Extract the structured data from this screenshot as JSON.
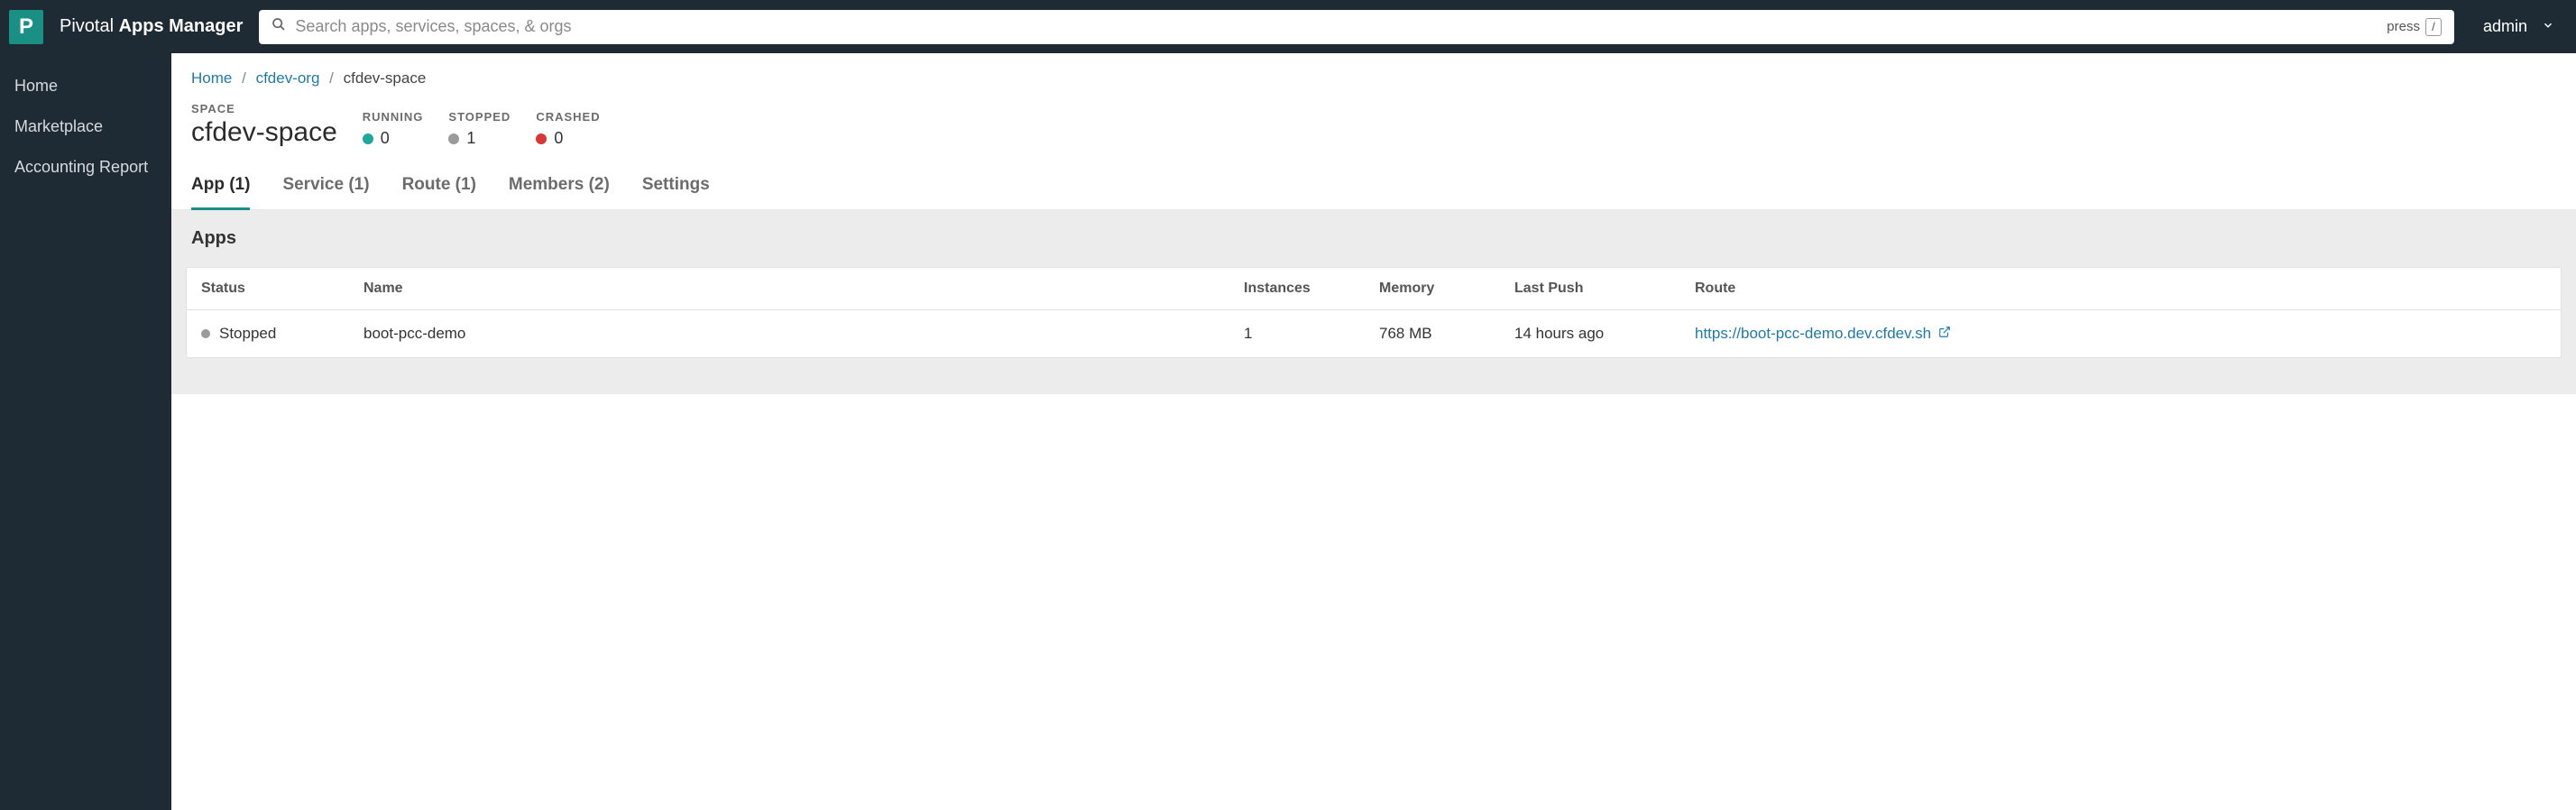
{
  "header": {
    "logo_letter": "P",
    "brand_prefix": "Pivotal ",
    "brand_bold": "Apps Manager",
    "search_placeholder": "Search apps, services, spaces, & orgs",
    "press_label": "press",
    "press_key": "/",
    "user": "admin"
  },
  "sidebar": {
    "items": [
      {
        "label": "Home"
      },
      {
        "label": "Marketplace"
      },
      {
        "label": "Accounting Report"
      }
    ]
  },
  "breadcrumb": {
    "home": "Home",
    "org": "cfdev-org",
    "current": "cfdev-space"
  },
  "space": {
    "label": "SPACE",
    "name": "cfdev-space",
    "stats": {
      "running": {
        "label": "RUNNING",
        "value": "0"
      },
      "stopped": {
        "label": "STOPPED",
        "value": "1"
      },
      "crashed": {
        "label": "CRASHED",
        "value": "0"
      }
    }
  },
  "tabs": [
    {
      "label": "App (1)",
      "active": true
    },
    {
      "label": "Service (1)",
      "active": false
    },
    {
      "label": "Route (1)",
      "active": false
    },
    {
      "label": "Members (2)",
      "active": false
    },
    {
      "label": "Settings",
      "active": false
    }
  ],
  "apps": {
    "section_title": "Apps",
    "columns": {
      "status": "Status",
      "name": "Name",
      "instances": "Instances",
      "memory": "Memory",
      "last_push": "Last Push",
      "route": "Route"
    },
    "rows": [
      {
        "status": "Stopped",
        "name": "boot-pcc-demo",
        "instances": "1",
        "memory": "768 MB",
        "last_push": "14 hours ago",
        "route": "https://boot-pcc-demo.dev.cfdev.sh"
      }
    ]
  }
}
